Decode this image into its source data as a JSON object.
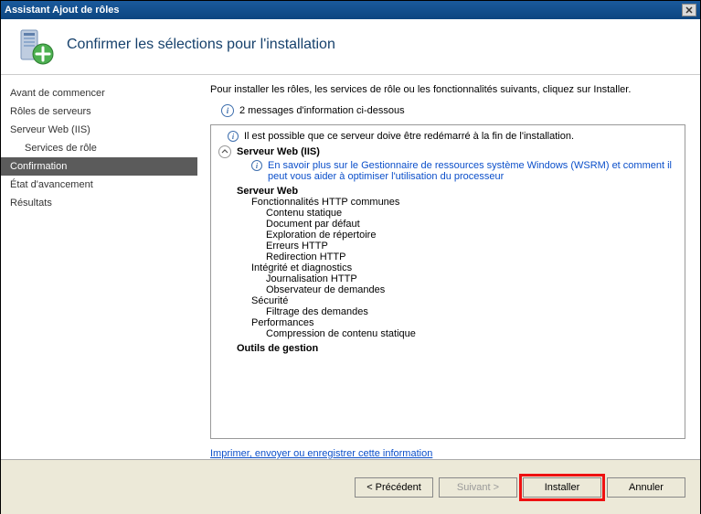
{
  "window": {
    "title": "Assistant Ajout de rôles"
  },
  "header": {
    "title": "Confirmer les sélections pour l'installation"
  },
  "sidebar": {
    "items": [
      {
        "label": "Avant de commencer",
        "indent": false,
        "selected": false
      },
      {
        "label": "Rôles de serveurs",
        "indent": false,
        "selected": false
      },
      {
        "label": "Serveur Web (IIS)",
        "indent": false,
        "selected": false
      },
      {
        "label": "Services de rôle",
        "indent": true,
        "selected": false
      },
      {
        "label": "Confirmation",
        "indent": false,
        "selected": true
      },
      {
        "label": "État d'avancement",
        "indent": false,
        "selected": false
      },
      {
        "label": "Résultats",
        "indent": false,
        "selected": false
      }
    ]
  },
  "content": {
    "instruction": "Pour installer les rôles, les services de rôle ou les fonctionnalités suivants, cliquez sur Installer.",
    "messages_header": "2 messages d'information ci-dessous",
    "restart_warning": "Il est possible que ce serveur doive être redémarré à la fin de l'installation.",
    "section_title": "Serveur Web (IIS)",
    "wsrm_link": "En savoir plus sur le Gestionnaire de ressources système Windows (WSRM) et comment il peut vous aider à optimiser l'utilisation du processeur",
    "tree": [
      {
        "level": 1,
        "label": "Serveur Web"
      },
      {
        "level": 2,
        "label": "Fonctionnalités HTTP communes"
      },
      {
        "level": 3,
        "label": "Contenu statique"
      },
      {
        "level": 3,
        "label": "Document par défaut"
      },
      {
        "level": 3,
        "label": "Exploration de répertoire"
      },
      {
        "level": 3,
        "label": "Erreurs HTTP"
      },
      {
        "level": 3,
        "label": "Redirection HTTP"
      },
      {
        "level": 2,
        "label": "Intégrité et diagnostics"
      },
      {
        "level": 3,
        "label": "Journalisation HTTP"
      },
      {
        "level": 3,
        "label": "Observateur de demandes"
      },
      {
        "level": 2,
        "label": "Sécurité"
      },
      {
        "level": 3,
        "label": "Filtrage des demandes"
      },
      {
        "level": 2,
        "label": "Performances"
      },
      {
        "level": 3,
        "label": "Compression de contenu statique"
      },
      {
        "level": 1,
        "label": "Outils de gestion"
      }
    ],
    "print_link": "Imprimer, envoyer ou enregistrer cette information"
  },
  "footer": {
    "previous": "< Précédent",
    "next": "Suivant >",
    "install": "Installer",
    "cancel": "Annuler"
  }
}
